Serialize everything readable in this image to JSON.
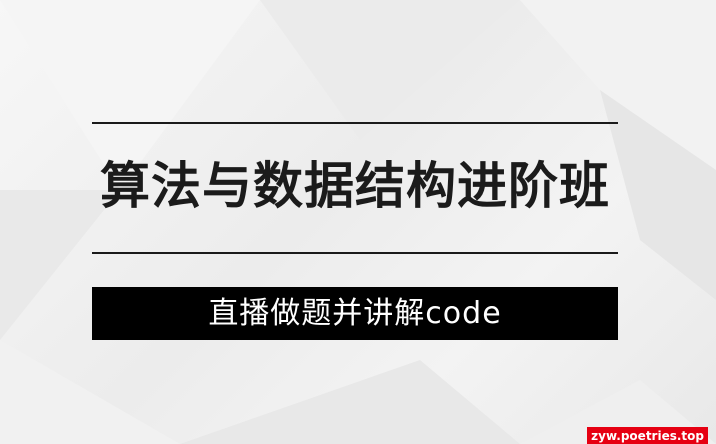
{
  "banner": {
    "title": "算法与数据结构进阶班",
    "subtitle": "直播做题并讲解code",
    "watermark": "zyw.poetries.top"
  },
  "colors": {
    "background": "#efefef",
    "text": "#1b1b1b",
    "subtitle_bar": "#000000",
    "subtitle_text": "#ffffff",
    "watermark_bg": "#e60012",
    "watermark_text": "#ffffff"
  }
}
